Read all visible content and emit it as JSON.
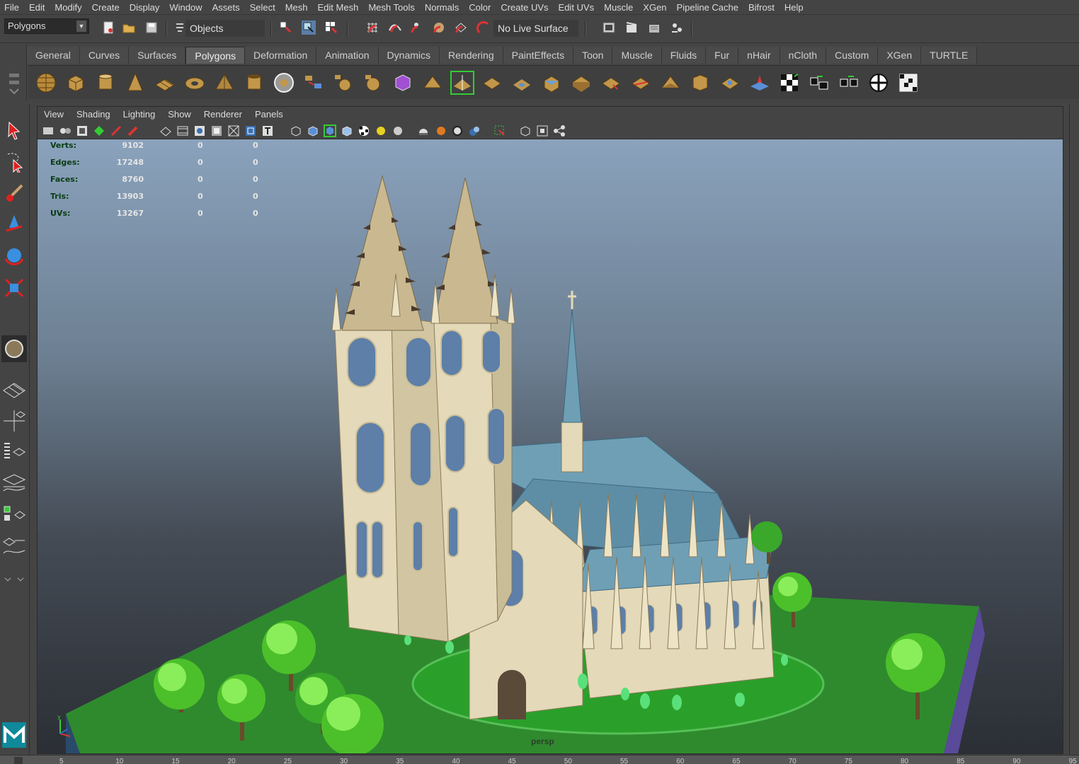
{
  "menubar": {
    "items": [
      "File",
      "Edit",
      "Modify",
      "Create",
      "Display",
      "Window",
      "Assets",
      "Select",
      "Mesh",
      "Edit Mesh",
      "Mesh Tools",
      "Normals",
      "Color",
      "Create UVs",
      "Edit UVs",
      "Muscle",
      "XGen",
      "Pipeline Cache",
      "Bifrost",
      "Help"
    ]
  },
  "statusline": {
    "mode": "Polygons",
    "selection_field": "Objects",
    "live_surface": "No Live Surface"
  },
  "shelf": {
    "tabs": [
      "General",
      "Curves",
      "Surfaces",
      "Polygons",
      "Deformation",
      "Animation",
      "Dynamics",
      "Rendering",
      "PaintEffects",
      "Toon",
      "Muscle",
      "Fluids",
      "Fur",
      "nHair",
      "nCloth",
      "Custom",
      "XGen",
      "TURTLE"
    ],
    "active_tab": "Polygons"
  },
  "panel": {
    "menu": [
      "View",
      "Shading",
      "Lighting",
      "Show",
      "Renderer",
      "Panels"
    ],
    "camera": "persp"
  },
  "hud": {
    "rows": [
      {
        "label": "Verts:",
        "total": "9102",
        "selected": "0",
        "component": "0"
      },
      {
        "label": "Edges:",
        "total": "17248",
        "selected": "0",
        "component": "0"
      },
      {
        "label": "Faces:",
        "total": "8760",
        "selected": "0",
        "component": "0"
      },
      {
        "label": "Tris:",
        "total": "13903",
        "selected": "0",
        "component": "0"
      },
      {
        "label": "UVs:",
        "total": "13267",
        "selected": "0",
        "component": "0"
      }
    ]
  },
  "timeline": {
    "ticks": [
      "5",
      "10",
      "15",
      "20",
      "25",
      "30",
      "35",
      "40",
      "45",
      "50",
      "55",
      "60",
      "65",
      "70",
      "75",
      "80",
      "85",
      "90",
      "95"
    ]
  },
  "colors": {
    "ui_bg": "#444444",
    "hud_label": "#0a3c12",
    "ground": "#2f8a2e",
    "roof": "#6f9fb5",
    "stone": "#e4d9b8",
    "tree": "#6ad63a"
  },
  "icons": {
    "toolbox": [
      "select-arrow-icon",
      "lasso-select-icon",
      "paint-select-icon",
      "move-tool-icon",
      "rotate-tool-icon",
      "scale-tool-icon",
      "last-tool-icon",
      "layout-single-icon",
      "layout-four-icon",
      "layout-outliner-icon",
      "layout-graph-icon",
      "layout-hypershade-icon",
      "layout-uv-icon",
      "maya-logo-icon"
    ]
  }
}
